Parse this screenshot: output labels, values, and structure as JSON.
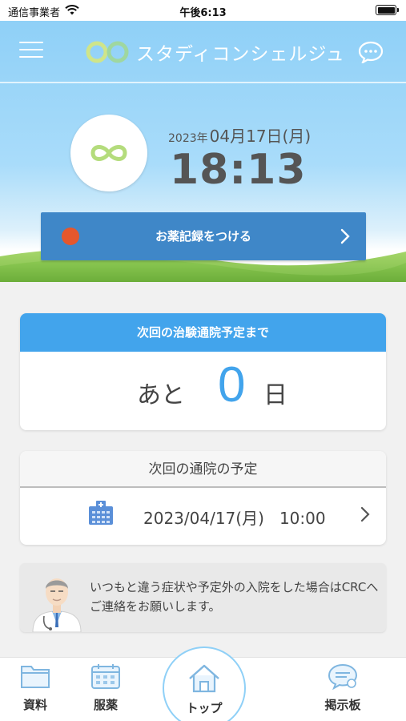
{
  "status_bar": {
    "carrier": "通信事業者",
    "time": "午後6:13"
  },
  "header": {
    "title": "スタディコンシェルジュ"
  },
  "clock": {
    "year": "2023年",
    "month_day": "04月17日(月)",
    "time": "18:13"
  },
  "record_button": {
    "label": "お薬記録をつける"
  },
  "countdown": {
    "header": "次回の治験通院予定まで",
    "prefix": "あと",
    "days": "0",
    "suffix": "日"
  },
  "next_visit": {
    "header": "次回の通院の予定",
    "datetime": "2023/04/17(月)   10:00"
  },
  "notice": {
    "text": "いつもと違う症状や予定外の入院をした場合はCRCへご連絡をお願いします。"
  },
  "tabbar": {
    "materials": "資料",
    "medication": "服薬",
    "top": "トップ",
    "board": "掲示板"
  },
  "colors": {
    "accent_blue": "#42a4ec",
    "button_blue": "#3f87c8",
    "record_dot": "#e5572c"
  }
}
